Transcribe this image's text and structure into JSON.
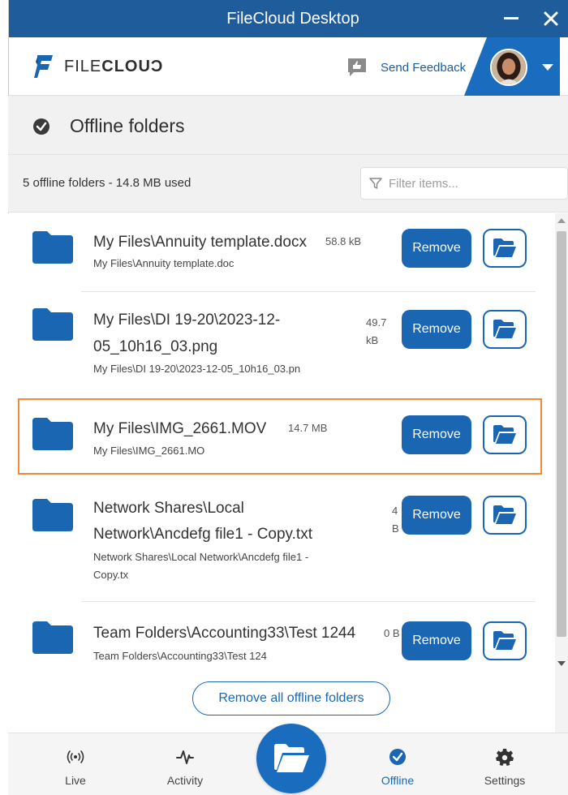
{
  "window": {
    "title": "FileCloud Desktop"
  },
  "header": {
    "logo_text_light": "FILE",
    "logo_text_bold": "CLOUƆ",
    "feedback_label": "Send Feedback"
  },
  "section": {
    "title": "Offline folders",
    "summary": "5 offline folders - 14.8 MB used",
    "filter_placeholder": "Filter items..."
  },
  "items": [
    {
      "name_lines": [
        "My Files\\Annuity template.docx"
      ],
      "size_lines": [
        "58.8 kB"
      ],
      "path_lines": [
        "My Files\\Annuity template.doc"
      ],
      "highlighted": false
    },
    {
      "name_lines": [
        "My Files\\DI 19-20\\2023-12-",
        "05_10h16_03.png"
      ],
      "size_lines": [
        "49.7",
        "kB"
      ],
      "path_lines": [
        "My Files\\DI 19-20\\2023-12-05_10h16_03.pn"
      ],
      "highlighted": false
    },
    {
      "name_lines": [
        "My Files\\IMG_2661.MOV"
      ],
      "size_lines": [
        "14.7 MB"
      ],
      "path_lines": [
        "My Files\\IMG_2661.MO"
      ],
      "highlighted": true
    },
    {
      "name_lines": [
        "Network Shares\\Local",
        "Network\\Ancdefg file1 - Copy.txt"
      ],
      "size_lines": [
        "4",
        "B"
      ],
      "path_lines": [
        "Network Shares\\Local Network\\Ancdefg file1 -",
        "Copy.tx"
      ],
      "highlighted": false
    },
    {
      "name_lines": [
        "Team Folders\\Accounting33\\Test 1244"
      ],
      "size_lines": [
        "0 B"
      ],
      "path_lines": [
        "Team Folders\\Accounting33\\Test 124"
      ],
      "highlighted": false
    }
  ],
  "buttons": {
    "remove_label": "Remove",
    "remove_all_label": "Remove all offline folders"
  },
  "bottom_nav": [
    {
      "label": "Live",
      "icon": "broadcast-icon",
      "active": false
    },
    {
      "label": "Activity",
      "icon": "pulse-icon",
      "active": false
    },
    {
      "label": "Offline",
      "icon": "check-circle-icon",
      "active": true
    },
    {
      "label": "Settings",
      "icon": "gear-icon",
      "active": false
    }
  ],
  "colors": {
    "titlebar": "#1f5c9c",
    "accent": "#1a66b3",
    "highlight": "#f28a3c"
  }
}
